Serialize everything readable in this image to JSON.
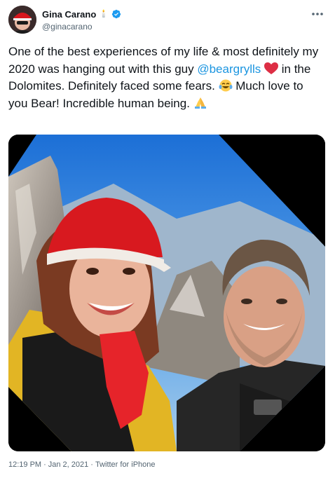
{
  "author": {
    "display_name": "Gina Carano",
    "name_emoji": "🕯️",
    "handle": "@ginacarano",
    "avatar_icon": "profile-photo",
    "verified_icon": "verified-badge-icon",
    "more_icon": "more-options-icon"
  },
  "tweet": {
    "text_part1": "One of the best experiences of my life & most definitely my 2020 was hanging out with this guy ",
    "mention": "@beargrylls",
    "text_part2": " in the Dolomites. Definitely faced some fears. ",
    "text_part3": " Much love to you Bear! Incredible human being. ",
    "emojis": [
      "red-heart",
      "tears-of-joy",
      "folded-hands"
    ]
  },
  "media": {
    "type": "photo",
    "description_icon": "selfie-photo"
  },
  "meta": {
    "time": "12:19 PM",
    "separator1": "·",
    "date": "Jan 2, 2021",
    "separator2": "·",
    "source": "Twitter for iPhone"
  },
  "colors": {
    "link": "#1b95e0",
    "verified": "#1d9bf0",
    "secondary_text": "#536471",
    "primary_text": "#0f1419"
  }
}
